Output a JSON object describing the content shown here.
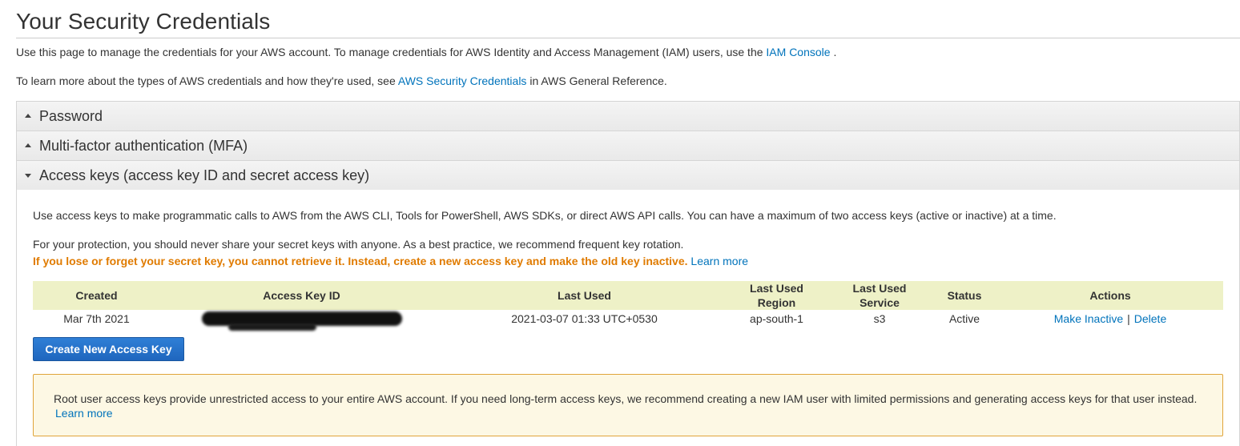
{
  "page": {
    "title": "Your Security Credentials",
    "intro1_pre": "Use this page to manage the credentials for your AWS account. To manage credentials for AWS Identity and Access Management (IAM) users, use the",
    "intro1_link": "IAM Console",
    "intro1_post": ".",
    "intro2_pre": "To learn more about the types of AWS credentials and how they're used, see",
    "intro2_link": "AWS Security Credentials",
    "intro2_post": "in AWS General Reference."
  },
  "sections": {
    "password": "Password",
    "mfa": "Multi-factor authentication (MFA)",
    "access_keys": "Access keys (access key ID and secret access key)"
  },
  "access_keys": {
    "description": "Use access keys to make programmatic calls to AWS from the AWS CLI, Tools for PowerShell, AWS SDKs, or direct AWS API calls. You can have a maximum of two access keys (active or inactive) at a time.",
    "protection": "For your protection, you should never share your secret keys with anyone. As a best practice, we recommend frequent key rotation.",
    "warning": "If you lose or forget your secret key, you cannot retrieve it. Instead, create a new access key and make the old key inactive.",
    "learn_more": "Learn more",
    "table": {
      "headers": [
        "Created",
        "Access Key ID",
        "Last Used",
        "Last Used Region",
        "Last Used Service",
        "Status",
        "Actions"
      ],
      "header_region_l1": "Last Used",
      "header_region_l2": "Region",
      "header_service_l1": "Last Used",
      "header_service_l2": "Service",
      "rows": [
        {
          "created": "Mar 7th 2021",
          "access_key_id": "",
          "last_used": "2021-03-07 01:33 UTC+0530",
          "region": "ap-south-1",
          "service": "s3",
          "status": "Active",
          "action_inactive": "Make Inactive",
          "action_delete": "Delete"
        }
      ]
    },
    "create_button": "Create New Access Key",
    "alert_text": "Root user access keys provide unrestricted access to your entire AWS account. If you need long-term access keys, we recommend creating a new IAM user with limited permissions and generating access keys for that user instead.",
    "alert_link": "Learn more"
  }
}
